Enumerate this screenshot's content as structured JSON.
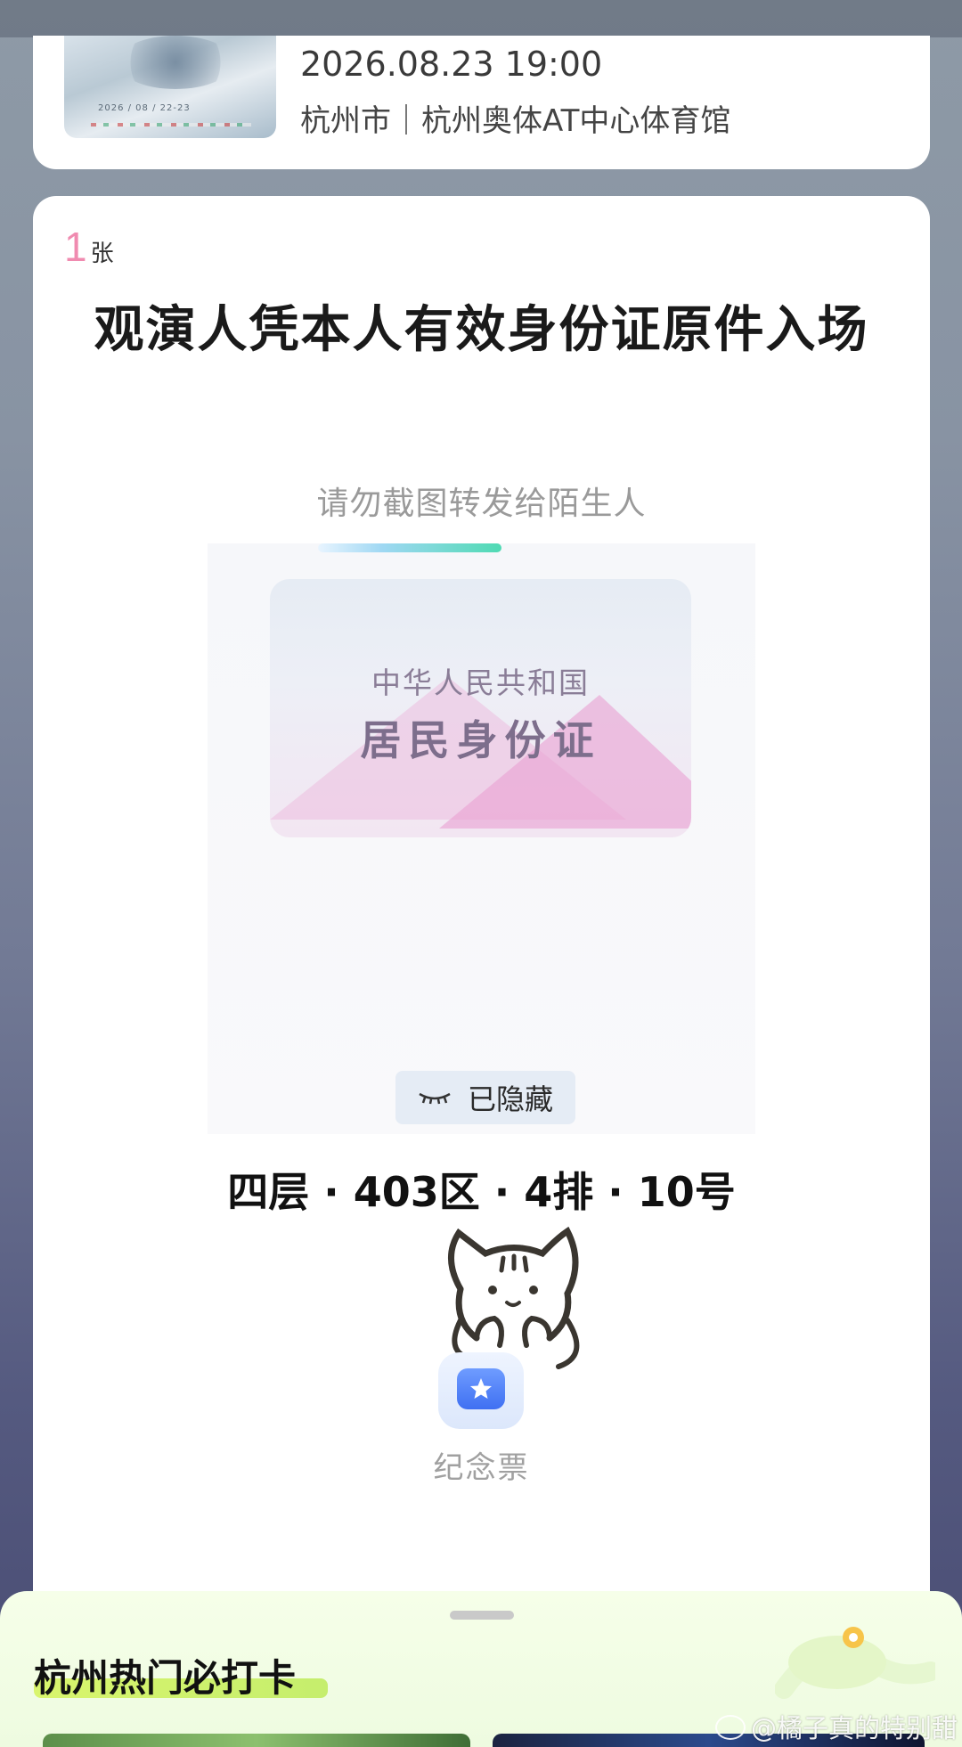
{
  "event": {
    "poster_text": "2026 / 08 / 22-23",
    "date": "2026.08.23 19:00",
    "venue": "杭州市｜杭州奥体AT中心体育馆"
  },
  "ticket": {
    "count": "1",
    "count_unit": "张",
    "entry_notice": "观演人凭本人有效身份证原件入场",
    "warning": "请勿截图转发给陌生人",
    "id_card": {
      "line1": "中华人民共和国",
      "line2": "居民身份证"
    },
    "hidden_label": "已隐藏",
    "seat": "四层 · 403区 · 4排 · 10号",
    "souvenir_label": "纪念票",
    "refresh_progress": 0.7
  },
  "bottom_sheet": {
    "title": "杭州热门必打卡"
  },
  "watermark": "@橘子真的特别甜",
  "colors": {
    "accent_pink": "#f08bb0",
    "progress_start": "#9fd8f3",
    "progress_end": "#4fdab3",
    "souvenir_blue": "#3f70f2",
    "highlight_green": "#d9f56d"
  }
}
